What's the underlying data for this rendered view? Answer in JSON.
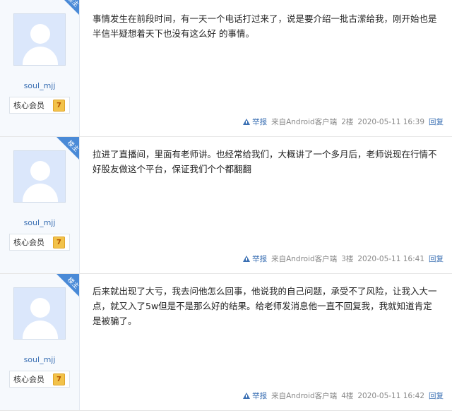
{
  "posts": [
    {
      "username": "soul_mjj",
      "role": "核心会员",
      "role_badge": "7",
      "op_tag": "楼主",
      "content": "事情发生在前段时间，有一天一个电话打过来了，说是要介绍一批古潆给我，刚开始也是半信半疑想着天下也没有这么好 的事情。",
      "report": "举报",
      "source": "来自Android客户端",
      "floor": "2楼",
      "time": "2020-05-11 16:39",
      "reply": "回复"
    },
    {
      "username": "soul_mjj",
      "role": "核心会员",
      "role_badge": "7",
      "op_tag": "楼主",
      "content": "拉进了直播间，里面有老师讲。也经常给我们，大概讲了一个多月后，老师说现在行情不好股友做这个平台，保证我们个个都翻翻",
      "report": "举报",
      "source": "来自Android客户端",
      "floor": "3楼",
      "time": "2020-05-11 16:41",
      "reply": "回复"
    },
    {
      "username": "soul_mjj",
      "role": "核心会员",
      "role_badge": "7",
      "op_tag": "楼主",
      "content": "后来就出现了大亏，我去问他怎么回事，他说我的自己问题，承受不了风险，让我入大一点，就又入了5w但是不是那么好的结果。给老师发消息他一直不回复我，我就知道肯定是被骗了。",
      "report": "举报",
      "source": "来自Android客户端",
      "floor": "4楼",
      "time": "2020-05-11 16:42",
      "reply": "回复"
    }
  ]
}
